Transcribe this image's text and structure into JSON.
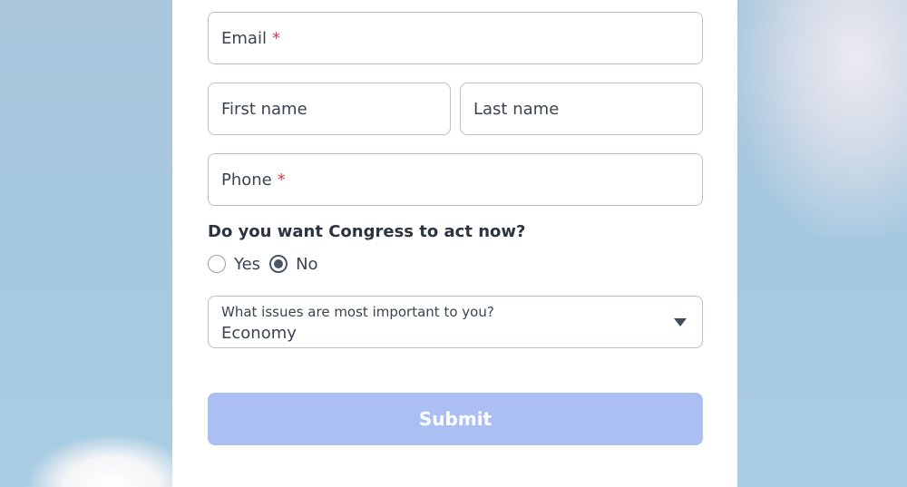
{
  "form": {
    "email": {
      "label": "Email",
      "required_mark": "*"
    },
    "first_name": {
      "label": "First name"
    },
    "last_name": {
      "label": "Last name"
    },
    "phone": {
      "label": "Phone",
      "required_mark": "*"
    },
    "question": "Do you want Congress to act now?",
    "options": [
      {
        "label": "Yes",
        "selected": false
      },
      {
        "label": "No",
        "selected": true
      }
    ],
    "issues": {
      "label": "What issues are most important to you?",
      "value": "Economy"
    },
    "submit_label": "Submit"
  },
  "colors": {
    "required": "#d43a4a",
    "submit_bg": "#abbff3",
    "background_sky": "#a9c6dc"
  }
}
